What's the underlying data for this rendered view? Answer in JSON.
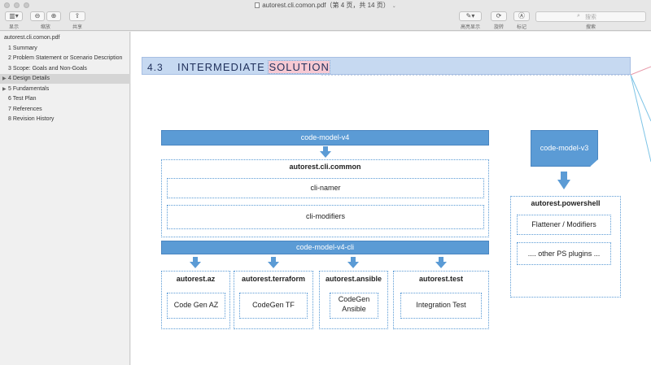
{
  "window": {
    "title": "autorest.cli.comon.pdf（第 4 页，共 14 页）"
  },
  "toolbar": {
    "sidebar_label": "显示",
    "zoom_label": "缩放",
    "share_label": "共享",
    "highlight_label": "高亮显示",
    "rotate_label": "旋转",
    "markup_label": "标记",
    "search_label": "搜索",
    "search_placeholder": "搜索"
  },
  "sidebar": {
    "doc_name": "autorest.cli.comon.pdf",
    "items": [
      {
        "label": "1 Summary",
        "expandable": false,
        "selected": false
      },
      {
        "label": "2 Problem Statement or Scenario Description",
        "expandable": false,
        "selected": false
      },
      {
        "label": "3 Scope: Goals and Non-Goals",
        "expandable": false,
        "selected": false
      },
      {
        "label": "4 Design Details",
        "expandable": true,
        "selected": true
      },
      {
        "label": "5 Fundamentals",
        "expandable": true,
        "selected": false
      },
      {
        "label": "6 Test Plan",
        "expandable": false,
        "selected": false
      },
      {
        "label": "7 References",
        "expandable": false,
        "selected": false
      },
      {
        "label": "8 Revision History",
        "expandable": false,
        "selected": false
      }
    ]
  },
  "page": {
    "section_number": "4.3",
    "section_title_prefix": "INTERMEDIATE ",
    "section_title_highlight": "SOLUTION"
  },
  "diagram": {
    "top_bar": "code-model-v4",
    "common_title": "autorest.cli.common",
    "common_items": [
      "cli-namer",
      "cli-modifiers"
    ],
    "cli_bar": "code-model-v4-cli",
    "targets": [
      {
        "title": "autorest.az",
        "item": "Code Gen AZ"
      },
      {
        "title": "autorest.terraform",
        "item": "CodeGen TF"
      },
      {
        "title": "autorest.ansible",
        "item": "CodeGen Ansible"
      },
      {
        "title": "autorest.test",
        "item": "Integration Test"
      }
    ],
    "v3_box": "code-model-v3",
    "powershell_title": "autorest.powershell",
    "powershell_items": [
      "Flattener / Modifiers",
      ".... other PS plugins ..."
    ],
    "colors": {
      "bar": "#5b9bd5",
      "heading_band": "#c6d9f1",
      "highlight": "#f7c9d3"
    }
  }
}
